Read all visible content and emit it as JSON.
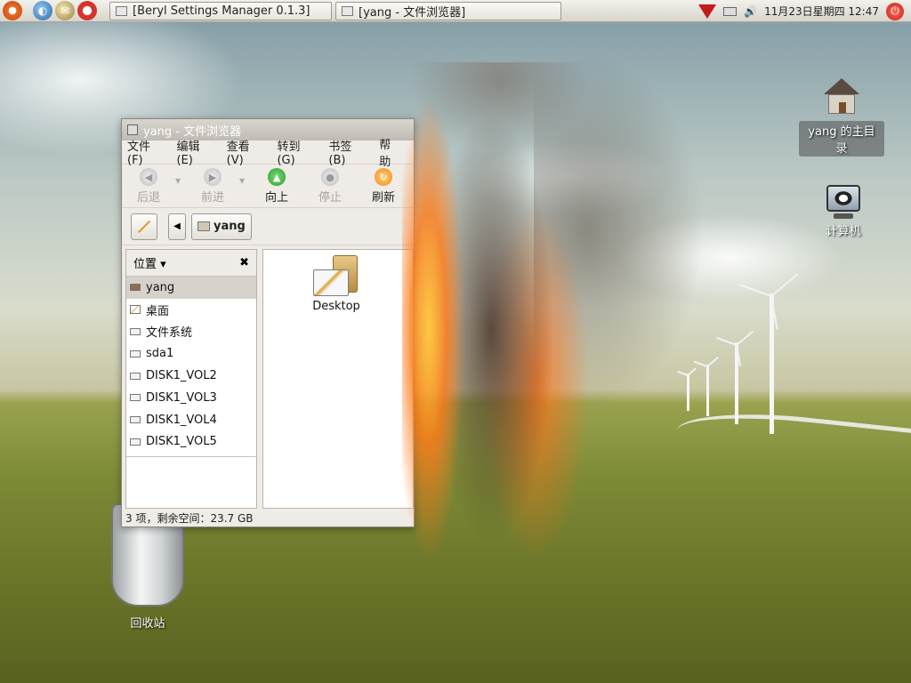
{
  "top_panel": {
    "tasks": [
      {
        "label": "[Beryl Settings Manager 0.1.3]"
      },
      {
        "label": "[yang - 文件浏览器]"
      }
    ],
    "clock": "11月23日星期四 12:47",
    "icons": [
      "ubuntu-logo-icon",
      "web-browser-icon",
      "mail-icon",
      "help-icon",
      "beryl-ruby-icon",
      "printer-icon",
      "volume-icon",
      "power-icon"
    ]
  },
  "desktop": {
    "home_label": "yang 的主目录",
    "computer_label": "计算机",
    "trash_label": "回收站"
  },
  "window": {
    "title": "yang - 文件浏览器",
    "menu": [
      "文件(F)",
      "编辑(E)",
      "查看(V)",
      "转到(G)",
      "书签(B)",
      "帮助"
    ],
    "toolbar": {
      "back": "后退",
      "forward": "前进",
      "up": "向上",
      "stop": "停止",
      "refresh": "刷新"
    },
    "location": {
      "path": "yang"
    },
    "sidebar": {
      "header": "位置",
      "items": [
        {
          "label": "yang"
        },
        {
          "label": "桌面"
        },
        {
          "label": "文件系统"
        },
        {
          "label": "sda1"
        },
        {
          "label": "DISK1_VOL2"
        },
        {
          "label": "DISK1_VOL3"
        },
        {
          "label": "DISK1_VOL4"
        },
        {
          "label": "DISK1_VOL5"
        }
      ]
    },
    "files": [
      {
        "name": "Desktop"
      }
    ],
    "status": "3 项，剩余空间：23.7 GB"
  }
}
